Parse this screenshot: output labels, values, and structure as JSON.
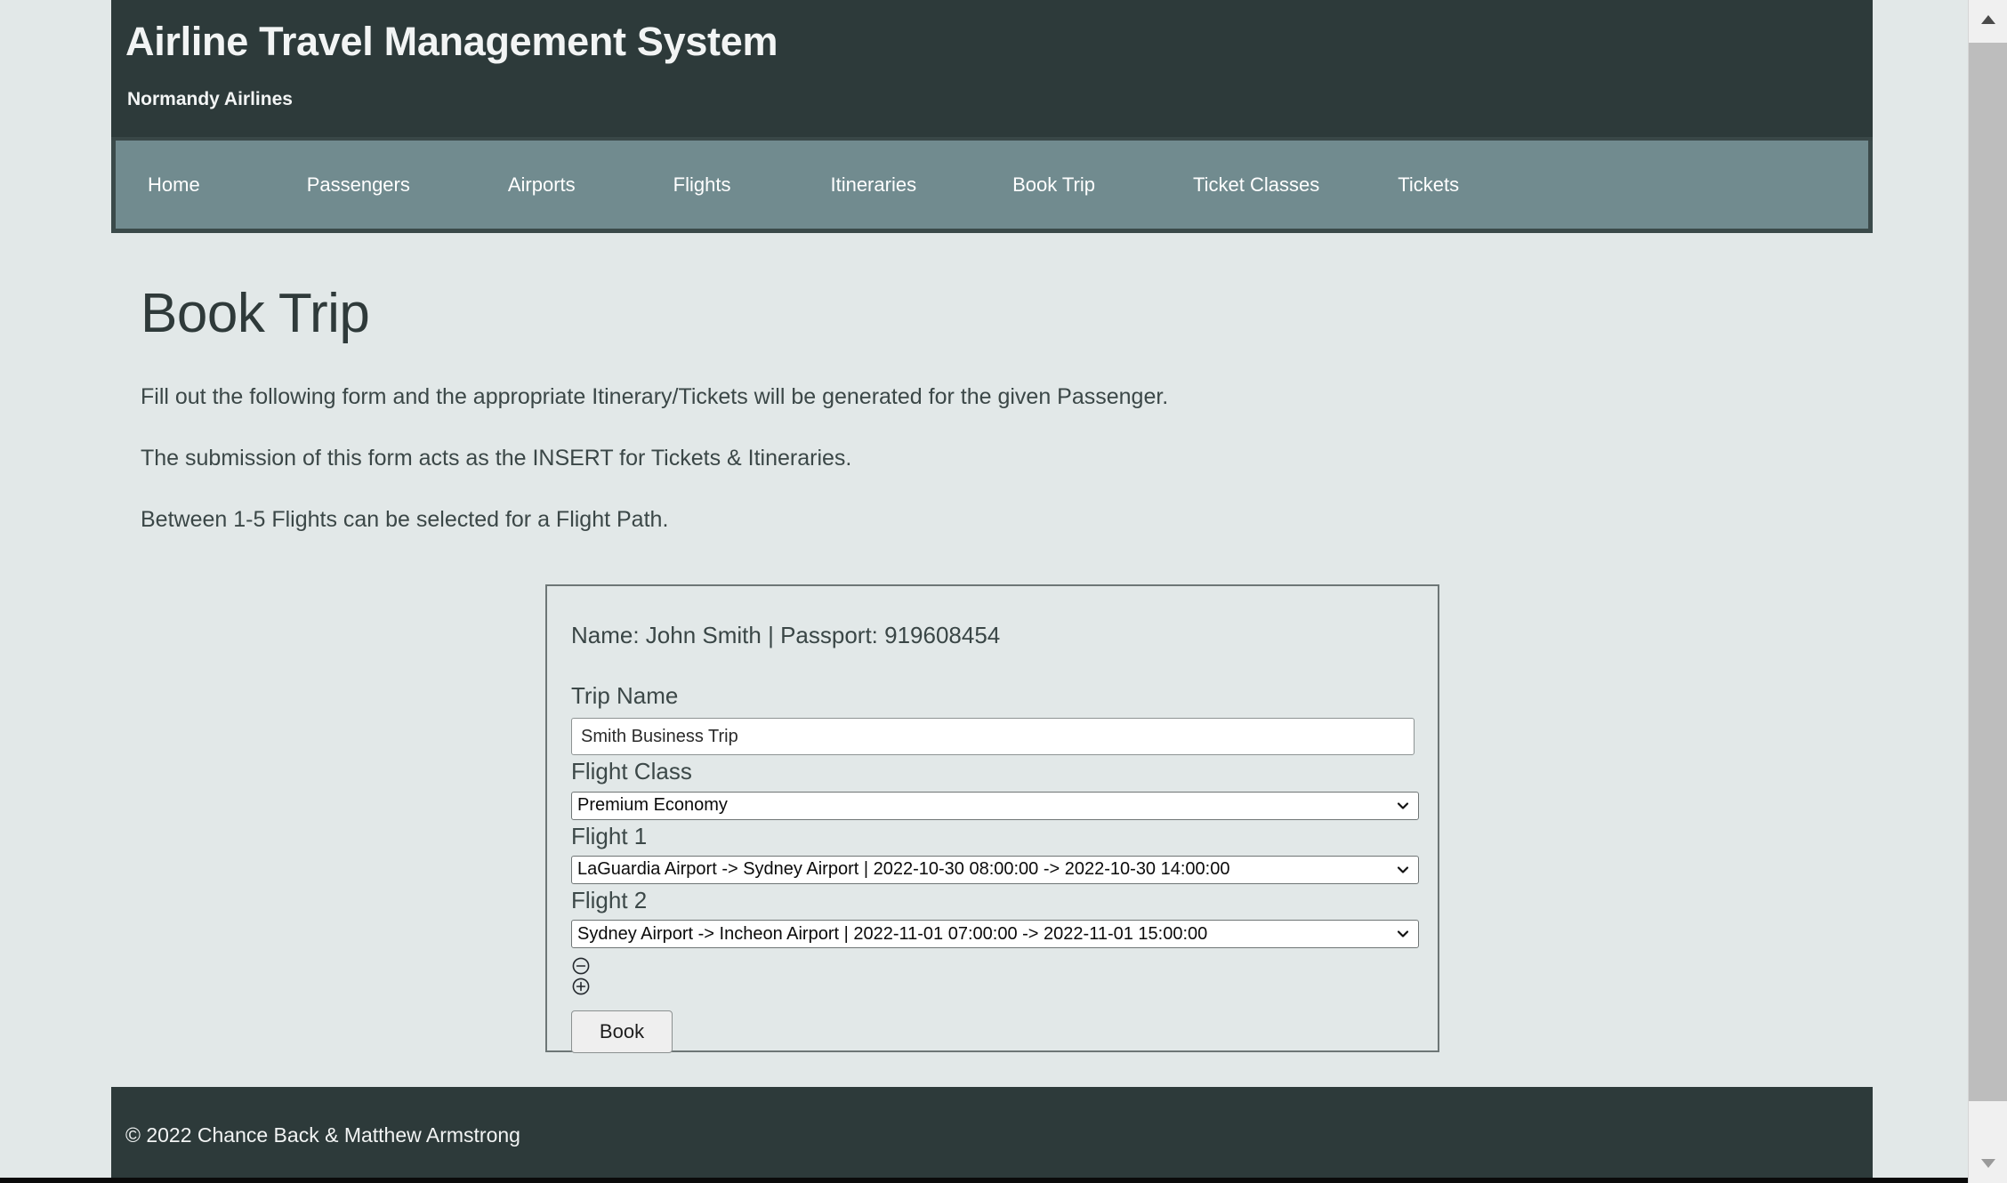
{
  "header": {
    "title": "Airline Travel Management System",
    "subtitle": "Normandy Airlines"
  },
  "nav": {
    "items": [
      {
        "label": "Home",
        "name": "nav-home"
      },
      {
        "label": "Passengers",
        "name": "nav-passengers"
      },
      {
        "label": "Airports",
        "name": "nav-airports"
      },
      {
        "label": "Flights",
        "name": "nav-flights"
      },
      {
        "label": "Itineraries",
        "name": "nav-itineraries"
      },
      {
        "label": "Book Trip",
        "name": "nav-book-trip"
      },
      {
        "label": "Ticket Classes",
        "name": "nav-ticket-classes"
      },
      {
        "label": "Tickets",
        "name": "nav-tickets"
      }
    ]
  },
  "main": {
    "page_title": "Book Trip",
    "paragraph_1": "Fill out the following form and the appropriate Itinerary/Tickets will be generated for the given Passenger.",
    "paragraph_2": "The submission of this form acts as the INSERT for Tickets & Itineraries.",
    "paragraph_3": "Between 1-5 Flights can be selected for a Flight Path."
  },
  "form": {
    "passenger_line": "Name: John Smith | Passport: 919608454",
    "trip_name_label": "Trip Name",
    "trip_name_value": "Smith Business Trip",
    "trip_name_placeholder": "Trip Name",
    "flight_class_label": "Flight Class",
    "flight_class_value": "Premium Economy",
    "flight_1_label": "Flight 1",
    "flight_1_value": "LaGuardia Airport -> Sydney Airport | 2022-10-30 08:00:00 -> 2022-10-30 14:00:00",
    "flight_2_label": "Flight 2",
    "flight_2_value": "Sydney Airport -> Incheon Airport | 2022-11-01 07:00:00 -> 2022-11-01 15:00:00",
    "remove_flight_icon": "minus-circle-icon",
    "add_flight_icon": "plus-circle-icon",
    "submit_label": "Book"
  },
  "footer": {
    "copyright": "© 2022 Chance Back & Matthew Armstrong"
  },
  "colors": {
    "page_background": "#e2e8e8",
    "header_background": "#2d3a3a",
    "nav_background": "#718b8f",
    "nav_border": "#3b4a4a",
    "text_light": "#f2f4f4",
    "text_dark": "#3b4747",
    "card_border": "#6d7676",
    "button_background": "#efefef"
  },
  "scrollbar": {
    "up_icon": "triangle-up-icon",
    "down_icon": "triangle-down-icon"
  }
}
